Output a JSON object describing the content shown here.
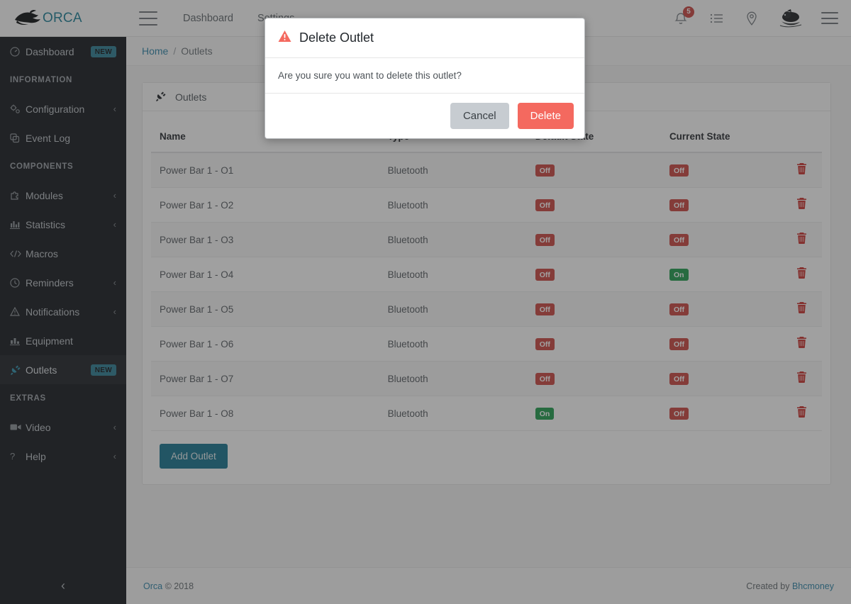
{
  "header": {
    "brand": "ORCA",
    "menu_icon": "hamburger-icon",
    "nav": [
      {
        "label": "Dashboard"
      },
      {
        "label": "Settings"
      }
    ],
    "right_icons": [
      {
        "name": "notifications-bell-icon",
        "badge": "5"
      },
      {
        "name": "task-list-icon"
      },
      {
        "name": "location-pin-icon"
      },
      {
        "name": "user-avatar"
      },
      {
        "name": "right-menu-hamburger-icon"
      }
    ]
  },
  "sidebar": {
    "items": [
      {
        "label": "Dashboard",
        "icon": "gauge-icon",
        "badge": "NEW",
        "chevron": false,
        "active": false
      },
      {
        "label": "INFORMATION",
        "type": "section"
      },
      {
        "label": "Configuration",
        "icon": "cogs-icon",
        "chevron": true,
        "active": false
      },
      {
        "label": "Event Log",
        "icon": "copy-icon",
        "chevron": false,
        "active": false
      },
      {
        "label": "COMPONENTS",
        "type": "section"
      },
      {
        "label": "Modules",
        "icon": "puzzle-icon",
        "chevron": true,
        "active": false
      },
      {
        "label": "Statistics",
        "icon": "bar-chart-icon",
        "chevron": true,
        "active": false
      },
      {
        "label": "Macros",
        "icon": "code-icon",
        "chevron": false,
        "active": false
      },
      {
        "label": "Reminders",
        "icon": "clock-icon",
        "chevron": true,
        "active": false
      },
      {
        "label": "Notifications",
        "icon": "warning-triangle-icon",
        "chevron": true,
        "active": false
      },
      {
        "label": "Equipment",
        "icon": "chart-icon",
        "chevron": false,
        "active": false
      },
      {
        "label": "Outlets",
        "icon": "plug-icon",
        "badge": "NEW",
        "chevron": false,
        "active": true
      },
      {
        "label": "EXTRAS",
        "type": "section"
      },
      {
        "label": "Video",
        "icon": "video-camera-icon",
        "chevron": true,
        "active": false
      },
      {
        "label": "Help",
        "icon": "question-mark-icon",
        "chevron": true,
        "active": false
      }
    ],
    "collapse_icon": "chevron-left-icon"
  },
  "breadcrumb": {
    "home": "Home",
    "separator": "/",
    "current": "Outlets"
  },
  "card": {
    "title": "Outlets",
    "icon": "plug-icon",
    "add_button": "Add Outlet",
    "columns": [
      "Name",
      "Type",
      "Default State",
      "Current State",
      ""
    ],
    "rows": [
      {
        "name": "Power Bar 1 - O1",
        "type": "Bluetooth",
        "default_state": "Off",
        "current_state": "Off",
        "action": "delete-icon"
      },
      {
        "name": "Power Bar 1 - O2",
        "type": "Bluetooth",
        "default_state": "Off",
        "current_state": "Off",
        "action": "delete-icon"
      },
      {
        "name": "Power Bar 1 - O3",
        "type": "Bluetooth",
        "default_state": "Off",
        "current_state": "Off",
        "action": "delete-icon"
      },
      {
        "name": "Power Bar 1 - O4",
        "type": "Bluetooth",
        "default_state": "Off",
        "current_state": "On",
        "action": "delete-icon"
      },
      {
        "name": "Power Bar 1 - O5",
        "type": "Bluetooth",
        "default_state": "Off",
        "current_state": "Off",
        "action": "delete-icon"
      },
      {
        "name": "Power Bar 1 - O6",
        "type": "Bluetooth",
        "default_state": "Off",
        "current_state": "Off",
        "action": "delete-icon"
      },
      {
        "name": "Power Bar 1 - O7",
        "type": "Bluetooth",
        "default_state": "Off",
        "current_state": "Off",
        "action": "delete-icon"
      },
      {
        "name": "Power Bar 1 - O8",
        "type": "Bluetooth",
        "default_state": "On",
        "current_state": "Off",
        "action": "delete-icon"
      }
    ]
  },
  "modal": {
    "icon": "warning-triangle-icon",
    "title": "Delete Outlet",
    "message": "Are you sure you want to delete this outlet?",
    "cancel_label": "Cancel",
    "confirm_label": "Delete"
  },
  "footer": {
    "brand": "Orca",
    "copyright": "© 2018",
    "created_label": "Created by",
    "author": "Bhcmoney"
  },
  "colors": {
    "accent_teal": "#2e84a8",
    "brand_teal": "#1b7e96",
    "state_on": "#1f9c4d",
    "state_off": "#c9453f",
    "delete_red": "#f4695f",
    "sidebar_bg": "#14171c",
    "new_badge": "#2c7d93"
  }
}
